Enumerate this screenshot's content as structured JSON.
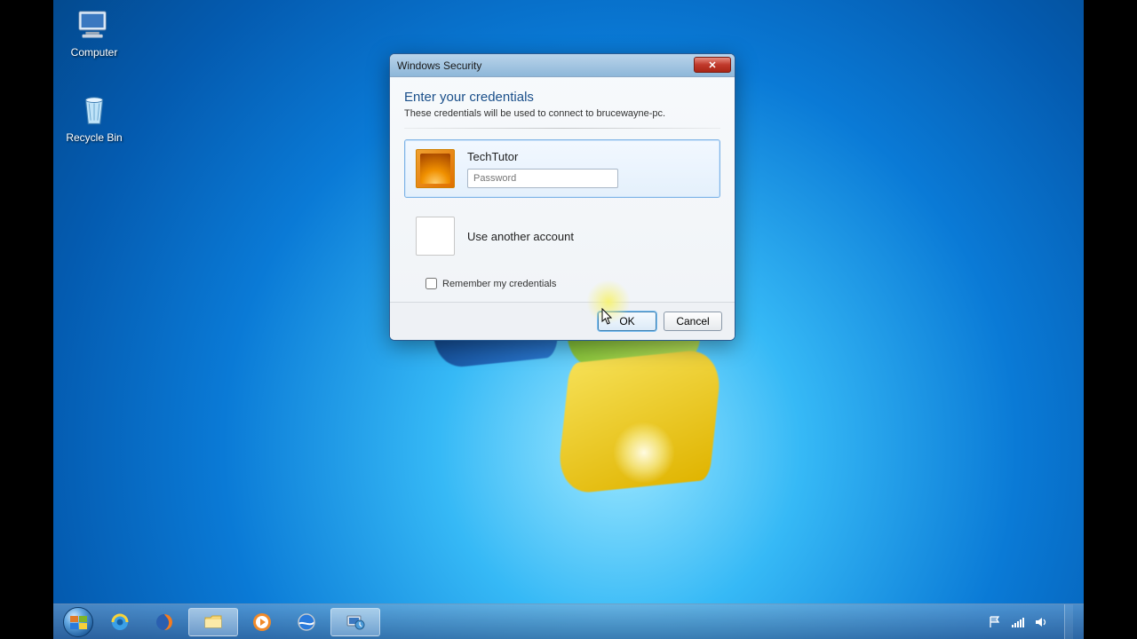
{
  "desktop": {
    "icons": {
      "computer": "Computer",
      "recycle_bin": "Recycle Bin"
    }
  },
  "dialog": {
    "title": "Windows Security",
    "heading": "Enter your credentials",
    "subtext": "These credentials will be used to connect to brucewayne-pc.",
    "account_name": "TechTutor",
    "password_placeholder": "Password",
    "alt_account_label": "Use another account",
    "remember_label": "Remember my credentials",
    "ok_label": "OK",
    "cancel_label": "Cancel"
  },
  "taskbar": {
    "start": "Start",
    "pinned": {
      "ie": "Internet Explorer",
      "firefox": "Firefox",
      "explorer": "Windows Explorer",
      "wmp": "Windows Media Player",
      "earth": "Google Earth",
      "rdp": "Remote Desktop Connection"
    },
    "tray": {
      "action_center": "Action Center",
      "network_signal": "Network signal",
      "volume": "Volume"
    }
  }
}
